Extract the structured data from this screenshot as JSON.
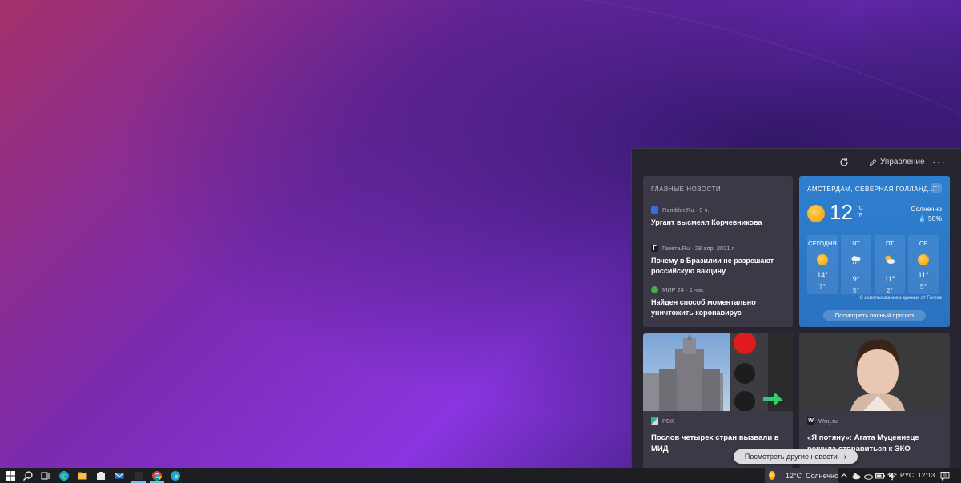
{
  "panel": {
    "manage_label": "Управление",
    "more_label": "···",
    "top_news": {
      "title": "ГЛАВНЫЕ НОВОСТИ",
      "items": [
        {
          "source": "Rambler.Ru · 9 ч.",
          "headline": "Ургант высмеял Корчевникова",
          "logo_color": "#3a6ce0"
        },
        {
          "source": "Газета.Ru · 28 апр. 2021 г.",
          "headline": "Почему в Бразилии не разрешают российскую вакцину",
          "logo_color": "#ffffff"
        },
        {
          "source": "МИР 24 · 1 час",
          "headline": "Найден способ моментально уничтожить коронавирус",
          "logo_color": "#3cb04a"
        }
      ]
    },
    "weather": {
      "location": "АМСТЕРДАМ, СЕВЕРНАЯ ГОЛЛАНД...",
      "more_label": "···",
      "temp": "12",
      "unit_c": "°C",
      "unit_f": "°F",
      "condition": "Солнечно",
      "humidity": "50%",
      "days": [
        {
          "name": "СЕГОДНЯ",
          "icon": "sun-icon",
          "high": "14°",
          "low": "7°"
        },
        {
          "name": "ЧТ",
          "icon": "rain-cloud-icon",
          "high": "9°",
          "low": "5°"
        },
        {
          "name": "ПТ",
          "icon": "partly-cloudy-icon",
          "high": "11°",
          "low": "2°"
        },
        {
          "name": "СБ",
          "icon": "sun-icon",
          "high": "11°",
          "low": "5°"
        }
      ],
      "attribution": "С использованием данных от Foreca",
      "forecast_button": "Посмотреть полный прогноз"
    },
    "cards": [
      {
        "source": "РБК",
        "headline": "Послов четырех стран вызвали в МИД"
      },
      {
        "source": "Wmj.ru",
        "headline": "«Я потяну»: Агата Муцениеце решила отправиться к ЭКО"
      }
    ],
    "more_news_button": "Посмотреть другие новости"
  },
  "taskbar": {
    "weather_temp": "12°C",
    "weather_cond": "Солнечно",
    "language": "РУС",
    "time": "12:13"
  },
  "colors": {
    "accent": "#2f7fcf",
    "panel_bg": "#272530",
    "card_bg": "#3b3945"
  }
}
